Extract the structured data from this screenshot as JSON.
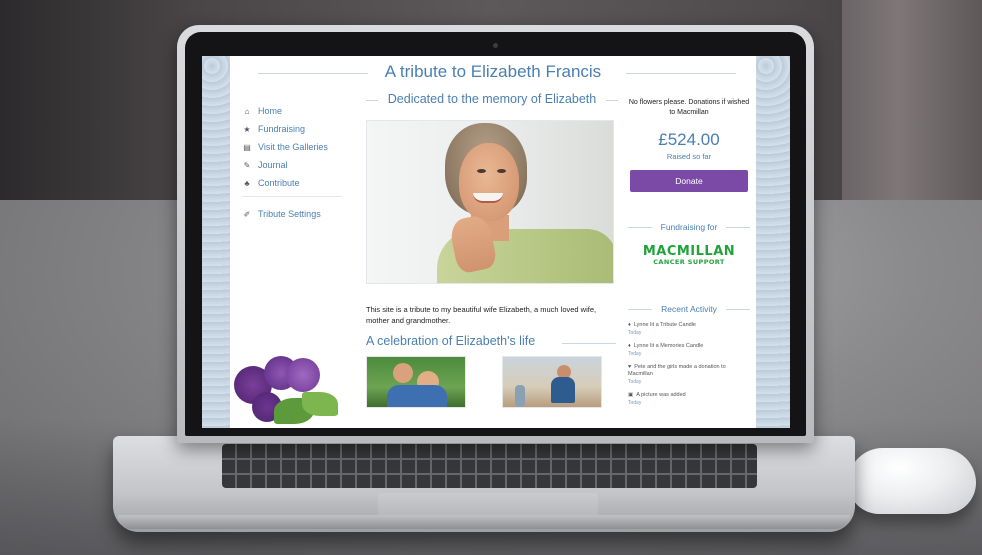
{
  "site": {
    "title": "A tribute to Elizabeth Francis",
    "nav": [
      {
        "label": "Home",
        "icon": "home-icon",
        "glyph": "⌂"
      },
      {
        "label": "Fundraising",
        "icon": "star-icon",
        "glyph": "★"
      },
      {
        "label": "Visit the Galleries",
        "icon": "gallery-icon",
        "glyph": "▤"
      },
      {
        "label": "Journal",
        "icon": "pencil-icon",
        "glyph": "✎"
      },
      {
        "label": "Contribute",
        "icon": "user-icon",
        "glyph": "♣"
      }
    ],
    "settings": {
      "label": "Tribute Settings",
      "icon": "wrench-icon",
      "glyph": "✐"
    },
    "main": {
      "dedicated_heading": "Dedicated to the memory of Elizabeth",
      "intro_text": "This site is a tribute to my beautiful wife Elizabeth, a much loved wife, mother and grandmother.",
      "celebration_heading": "A celebration of Elizabeth's life"
    },
    "right": {
      "note": "No flowers please. Donations if wished to Macmillan",
      "amount": "£524.00",
      "raised_label": "Raised so far",
      "donate_label": "Donate",
      "fundraising_heading": "Fundraising for",
      "logo_main": "MACMILLAN",
      "logo_sub": "CANCER SUPPORT",
      "recent_heading": "Recent Activity",
      "activity": [
        {
          "icon": "candle-icon",
          "glyph": "♦",
          "text": "Lynne lit a Tribute Candle",
          "time": "Today"
        },
        {
          "icon": "candle-icon",
          "glyph": "♦",
          "text": "Lynne lit a Memories Candle",
          "time": "Today"
        },
        {
          "icon": "heart-icon",
          "glyph": "♥",
          "text": "Pete and the girls made a donation to Macmillan",
          "time": "Today"
        },
        {
          "icon": "picture-icon",
          "glyph": "▣",
          "text": "A picture was added",
          "time": "Today"
        }
      ]
    }
  },
  "colors": {
    "accent_blue": "#4a7fb2",
    "donate_purple": "#7b4aa7",
    "macmillan_green": "#21a33b"
  }
}
